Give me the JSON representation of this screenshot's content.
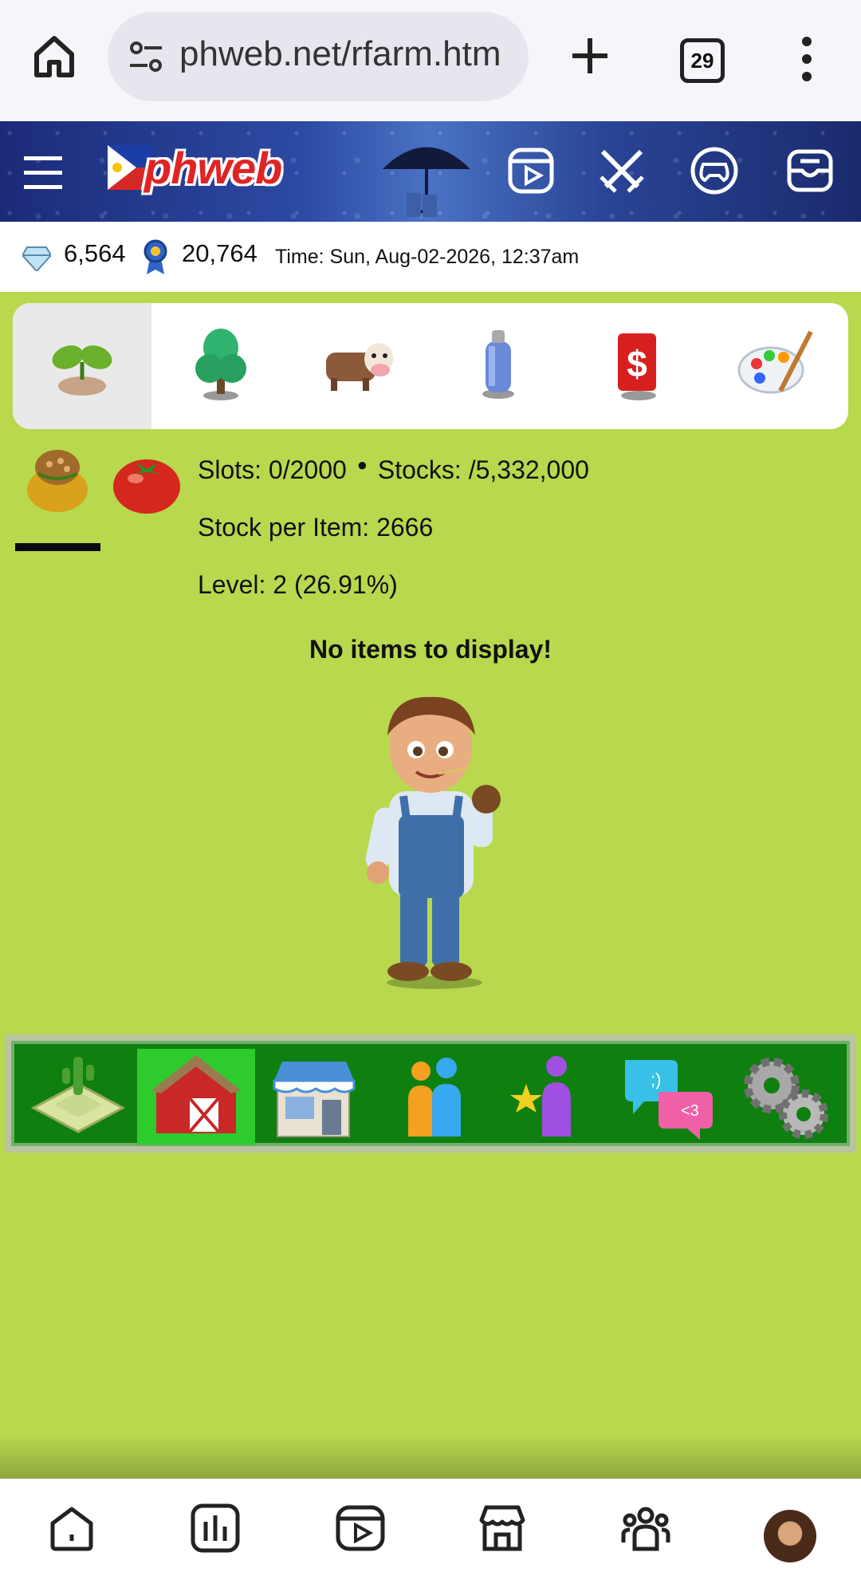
{
  "browser": {
    "url": "phweb.net/rfarm.htm",
    "tab_count": "29"
  },
  "site": {
    "logo_text": "phweb",
    "header_icons": [
      "reels-icon",
      "battle-icon",
      "game-controller-icon",
      "inbox-icon"
    ]
  },
  "stats": {
    "gems": "6,564",
    "points": "20,764",
    "time": "Time: Sun, Aug-02-2026, 12:37am"
  },
  "category_tabs": [
    {
      "name": "seedling-icon",
      "active": true
    },
    {
      "name": "tree-icon",
      "active": false
    },
    {
      "name": "cow-icon",
      "active": false
    },
    {
      "name": "spray-can-icon",
      "active": false
    },
    {
      "name": "dollar-sign-icon",
      "active": false
    },
    {
      "name": "paint-palette-icon",
      "active": false
    }
  ],
  "sub_tabs": [
    {
      "name": "seed-bag-icon",
      "active": true
    },
    {
      "name": "tomato-icon",
      "active": false
    }
  ],
  "info": {
    "slots": "Slots: 0/2000",
    "stocks": "Stocks: /5,332,000",
    "stock_per_item": "Stock per Item: 2666",
    "level": "Level: 2 (26.91%)"
  },
  "empty_message": "No items to display!",
  "game_nav": [
    {
      "name": "farm-field-icon",
      "active": false
    },
    {
      "name": "barn-icon",
      "active": true
    },
    {
      "name": "shop-icon",
      "active": false
    },
    {
      "name": "friends-icon",
      "active": false
    },
    {
      "name": "star-user-icon",
      "active": false
    },
    {
      "name": "chat-icon",
      "active": false
    },
    {
      "name": "settings-gears-icon",
      "active": false
    }
  ],
  "colors": {
    "background": "#b8d84e",
    "game_nav": "#0f7f10",
    "game_nav_active": "#2ecb2e",
    "header": "#2c4aa3"
  }
}
